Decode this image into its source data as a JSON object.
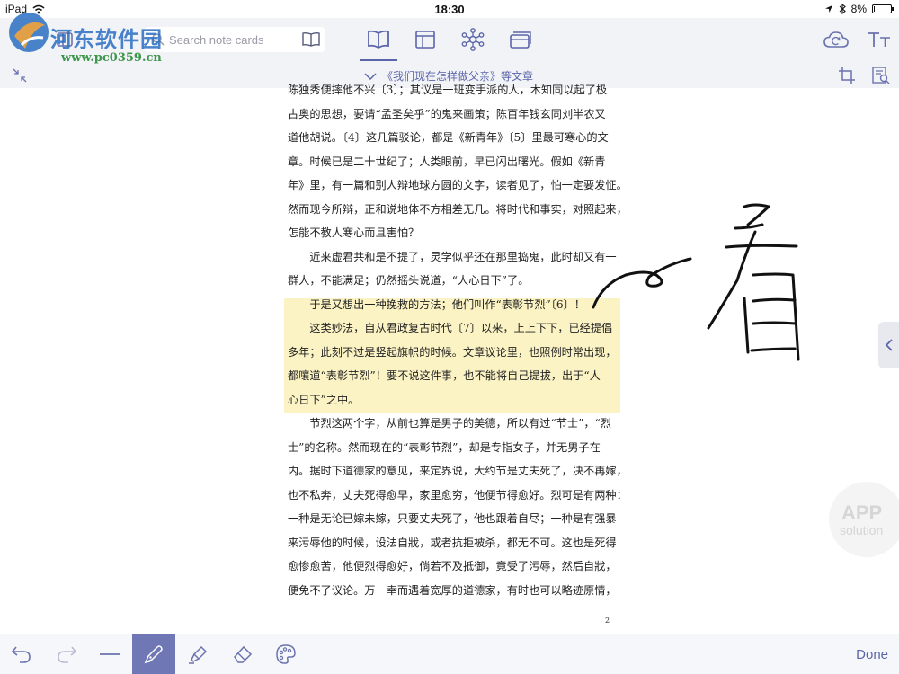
{
  "status_bar": {
    "device": "iPad",
    "time": "18:30",
    "battery": "8%",
    "battery_level_pct": 8
  },
  "toolbar": {
    "search_placeholder": "Search note cards",
    "tabs": [
      {
        "name": "reader",
        "icon": "open-book-icon",
        "active": true
      },
      {
        "name": "layout",
        "icon": "layout-panels-icon",
        "active": false
      },
      {
        "name": "mindmap",
        "icon": "network-icon",
        "active": false
      },
      {
        "name": "cards",
        "icon": "card-stack-icon",
        "active": false
      }
    ],
    "right_icons": [
      "cloud-sync-icon",
      "text-size-icon"
    ],
    "accent_color": "#5b65a9"
  },
  "titlebar": {
    "title": "《我们现在怎样做父亲》等文章"
  },
  "document": {
    "lines": [
      "陈独秀便摔他不兴〔3〕；其议是一班变手派的人，木知同以起了极",
      "古奥的思想，要请“孟圣矣乎”的鬼来画策；陈百年钱玄同刘半农又",
      "道他胡说。〔4〕这几篇驳论，都是《新青年》〔5〕里最可寒心的文",
      "章。时候已是二十世纪了；人类眼前，早已闪出曙光。假如《新青",
      "年》里，有一篇和别人辩地球方圆的文字，读者见了，怕一定要发怔。",
      "然而现今所辩，正和说地体不方相差无几。将时代和事实，对照起来，",
      "怎能不教人寒心而且害怕？",
      "　　近来虚君共和是不提了，灵学似乎还在那里捣鬼，此时却又有一",
      "群人，不能满足；仍然摇头说道，“人心日下”了。",
      "　　于是又想出一种挽救的方法；他们叫作“表彰节烈”〔6〕！",
      "　　这类妙法，自从君政复古时代〔7〕以来，上上下下，已经提倡",
      "多年；此刻不过是竖起旗帜的时候。文章议论里，也照例时常出现，",
      "都嚷道“表彰节烈”！要不说这件事，也不能将自己提拔，出于“人",
      "心日下”之中。",
      "　　节烈这两个字，从前也算是男子的美德，所以有过“节士”，“烈",
      "士”的名称。然而现在的“表彰节烈”，却是专指女子，并无男子在",
      "内。据时下道德家的意见，来定界说，大约节是丈夫死了，决不再嫁，",
      "也不私奔，丈夫死得愈早，家里愈穷，他便节得愈好。烈可是有两种：",
      "一种是无论已嫁未嫁，只要丈夫死了，他也跟着自尽；一种是有强暴",
      "来污辱他的时候，设法自戕，或者抗拒被杀，都无不可。这也是死得",
      "愈惨愈苦，他便烈得愈好，倘若不及抵御，竟受了污辱，然后自戕，",
      "便免不了议论。万一幸而遇着宽厚的道德家，有时也可以略迹原情，"
    ],
    "page_number": "2",
    "highlight_color": "#fbf3c4"
  },
  "handwriting": {
    "text": "看"
  },
  "watermarks": {
    "site_name": "河东软件园",
    "site_url": "www.pc0359.cn",
    "app_badge_line1": "APP",
    "app_badge_line2": "solution"
  },
  "bottom_bar": {
    "tools": [
      "undo-icon",
      "redo-icon",
      "line-icon",
      "pen-icon",
      "highlighter-icon",
      "eraser-icon",
      "palette-icon"
    ],
    "active_tool": "pen-icon",
    "done_label": "Done"
  }
}
